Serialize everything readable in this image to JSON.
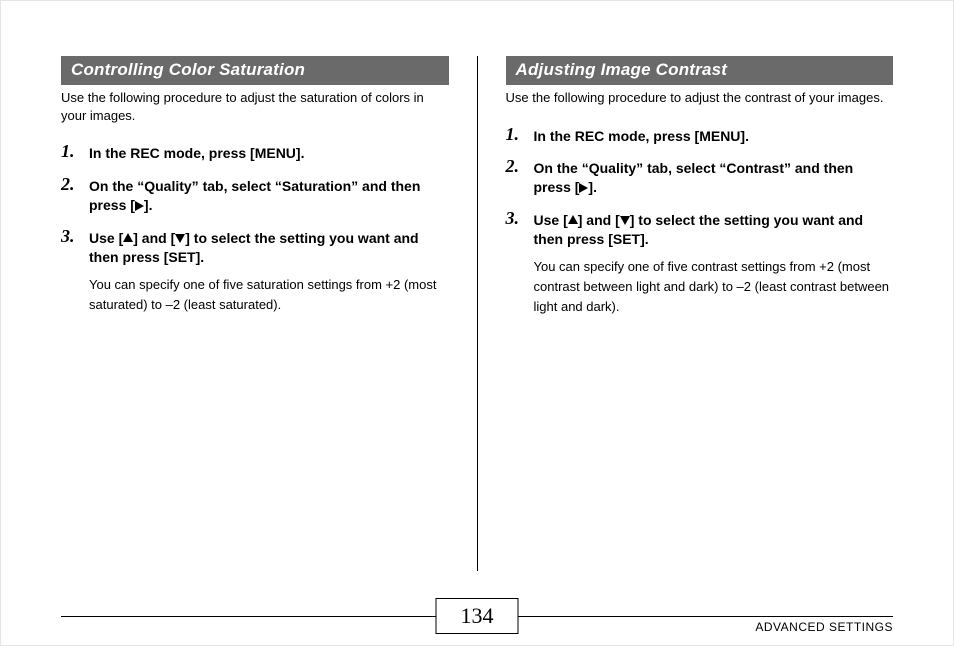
{
  "left": {
    "title": "Controlling Color Saturation",
    "intro": "Use the following procedure to adjust the saturation of colors in your images.",
    "steps": [
      {
        "body": "In the REC mode, press [MENU]."
      },
      {
        "body_pre": "On the “Quality” tab, select “Saturation” and then press [",
        "body_post": "]."
      },
      {
        "body_pre": "Use [",
        "body_mid": "] and [",
        "body_post": "] to select the setting you want and then press [SET].",
        "note": "You can specify one of five saturation settings from +2 (most saturated) to –2 (least saturated)."
      }
    ]
  },
  "right": {
    "title": "Adjusting Image Contrast",
    "intro": "Use the following procedure to adjust the contrast of your images.",
    "steps": [
      {
        "body": "In the REC mode, press [MENU]."
      },
      {
        "body_pre": "On the “Quality” tab, select “Contrast” and then press [",
        "body_post": "]."
      },
      {
        "body_pre": "Use [",
        "body_mid": "] and [",
        "body_post": "] to select the setting you want and then press [SET].",
        "note": "You can specify one of five contrast settings from +2 (most contrast between light and dark) to –2 (least contrast between light and dark)."
      }
    ]
  },
  "page_number": "134",
  "footer_label": "ADVANCED SETTINGS"
}
